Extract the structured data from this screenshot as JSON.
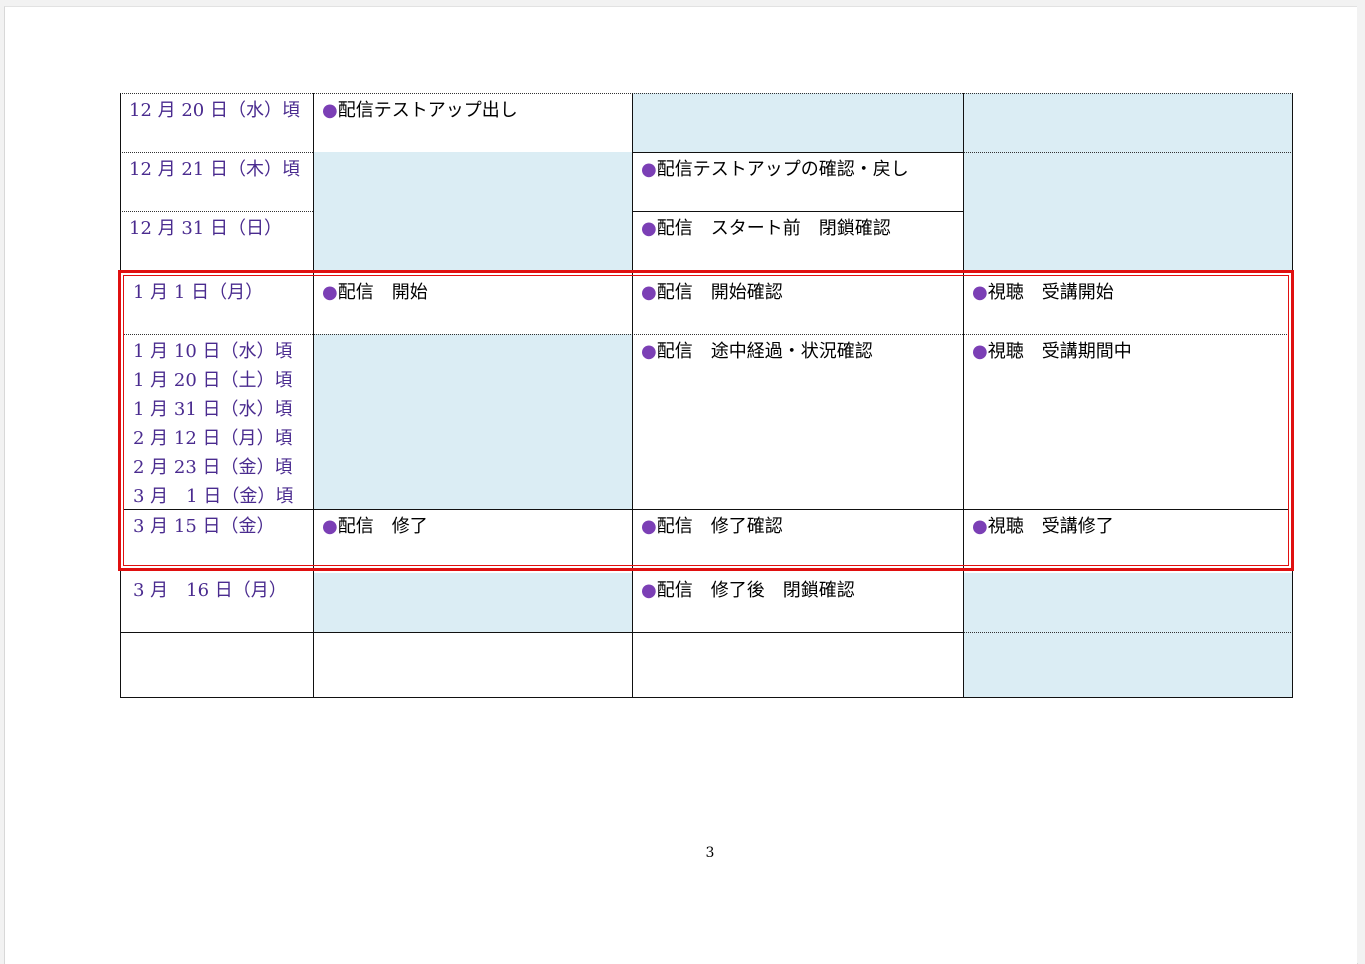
{
  "rows": {
    "r1": {
      "date": [
        "12 月 20 日（水）頃"
      ],
      "col2": "●配信テストアップ出し",
      "col3": "",
      "col4": ""
    },
    "r2": {
      "date": [
        "12 月 21 日（木）頃"
      ],
      "col3": "●配信テストアップの確認・戻し"
    },
    "r3": {
      "date": [
        "12 月 31 日（日）"
      ],
      "col3": "●配信　スタート前　閉鎖確認"
    },
    "r4": {
      "date": [
        "1 月 1 日（月）"
      ],
      "col2": "●配信　開始",
      "col3": "●配信　開始確認",
      "col4": "●視聴　受講開始"
    },
    "r5": {
      "date": [
        "1 月 10 日（水）頃",
        "1 月 20 日（土）頃",
        "1 月 31 日（水）頃",
        "2 月 12 日（月）頃",
        "2 月 23 日（金）頃",
        "3 月　1 日（金）頃"
      ],
      "col3": "●配信　途中経過・状況確認",
      "col4": "●視聴　受講期間中"
    },
    "r6": {
      "date": [
        "3 月 15 日（金）"
      ],
      "col2": "●配信　修了",
      "col3": "●配信　修了確認",
      "col4": "●視聴　受講修了"
    },
    "r7": {
      "date": [
        "3 月　16 日（月）"
      ],
      "col3": "●配信　修了後　閉鎖確認"
    }
  },
  "page_number": "3",
  "colors": {
    "shade": "#dbedf4",
    "date_text": "#4a2b8f",
    "bullet": "#7b3fb5",
    "highlight_box": "#e01010"
  }
}
